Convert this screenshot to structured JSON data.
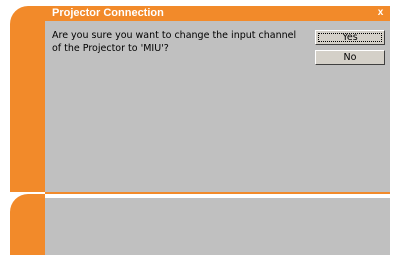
{
  "dialog": {
    "title": "Projector Connection",
    "close_label": "x",
    "message": "Are you sure you want to change the input channel of the Projector to 'MIU'?",
    "yes_label": "Yes",
    "no_label": "No"
  },
  "colors": {
    "accent": "#f28a2a",
    "panel": "#c0c0c0",
    "button": "#d4d0c8"
  }
}
